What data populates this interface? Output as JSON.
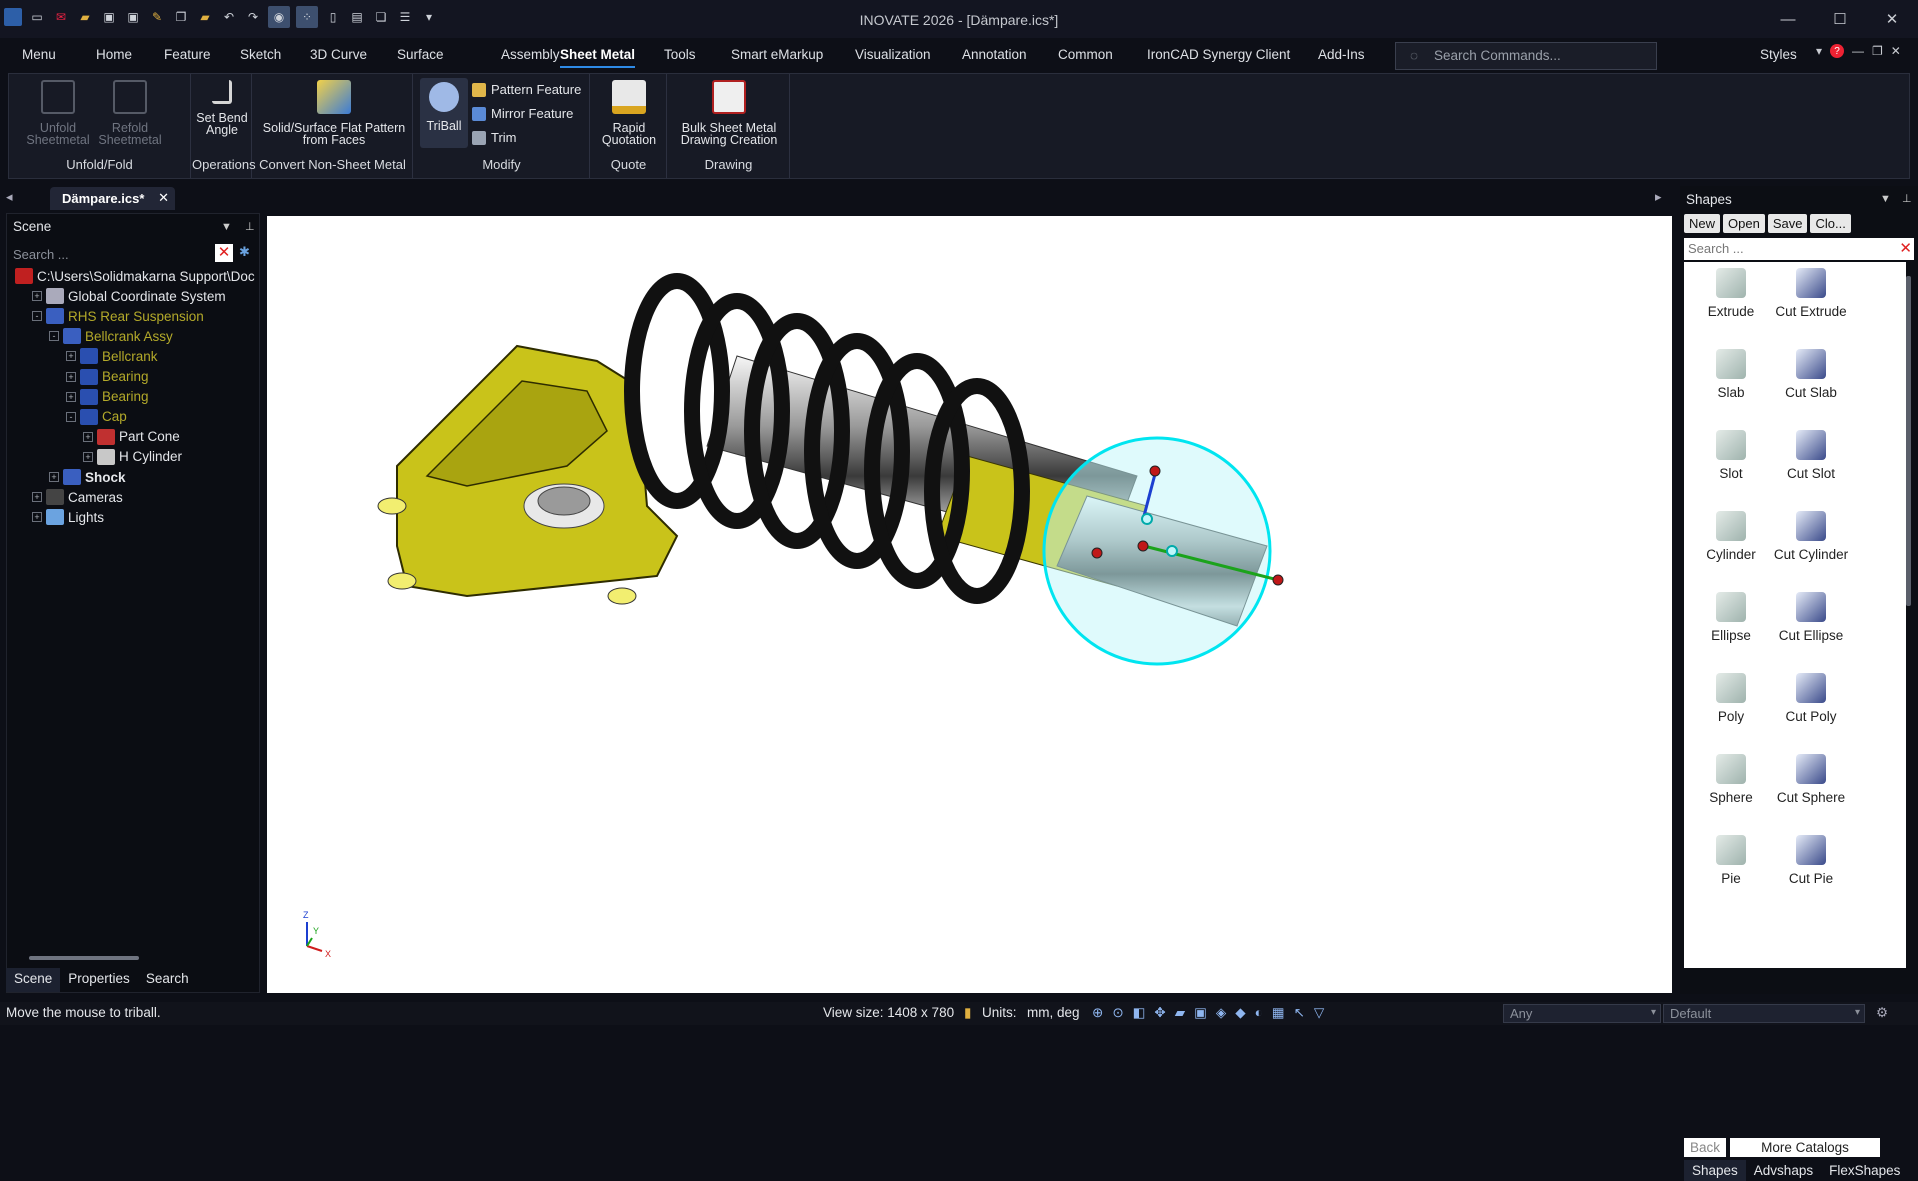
{
  "app": {
    "title": "INOVATE 2026 - [Dämpare.ics*]"
  },
  "menubar": {
    "tabs": [
      "Menu",
      "Home",
      "Feature",
      "Sketch",
      "3D Curve",
      "Surface",
      "Assembly",
      "Sheet Metal",
      "Tools",
      "Smart eMarkup",
      "Visualization",
      "Annotation",
      "Common",
      "IronCAD Synergy Client",
      "Add-Ins"
    ],
    "active": "Sheet Metal",
    "search_placeholder": "Search Commands...",
    "styles_label": "Styles"
  },
  "ribbon": {
    "groups": {
      "unfold_fold": {
        "label": "Unfold/Fold",
        "unfold": "Unfold Sheetmetal",
        "refold": "Refold Sheetmetal"
      },
      "operations": {
        "label": "Operations",
        "set_bend": "Set Bend Angle"
      },
      "convert": {
        "label": "Convert Non-Sheet Metal",
        "flat": "Solid/Surface Flat Pattern from Faces"
      },
      "modify": {
        "label": "Modify",
        "triball": "TriBall",
        "pattern": "Pattern Feature",
        "mirror": "Mirror Feature",
        "trim": "Trim"
      },
      "quote": {
        "label": "Quote",
        "rapid": "Rapid Quotation"
      },
      "drawing": {
        "label": "Drawing",
        "bulk": "Bulk Sheet Metal Drawing Creation"
      }
    }
  },
  "doc_tab": {
    "label": "Dämpare.ics*"
  },
  "scene": {
    "title": "Scene",
    "search_placeholder": "Search ...",
    "tree": [
      {
        "label": "C:\\Users\\Solidmakarna Support\\Doc",
        "level": 0,
        "expander": "",
        "style": "normal"
      },
      {
        "label": "Global Coordinate System",
        "level": 1,
        "expander": "+",
        "style": "normal"
      },
      {
        "label": "RHS Rear Suspension",
        "level": 1,
        "expander": "-",
        "style": "olive"
      },
      {
        "label": "Bellcrank Assy",
        "level": 2,
        "expander": "-",
        "style": "olive"
      },
      {
        "label": "Bellcrank",
        "level": 3,
        "expander": "+",
        "style": "olive"
      },
      {
        "label": "Bearing",
        "level": 3,
        "expander": "+",
        "style": "olive"
      },
      {
        "label": "Bearing",
        "level": 3,
        "expander": "+",
        "style": "olive"
      },
      {
        "label": "Cap",
        "level": 3,
        "expander": "-",
        "style": "olive"
      },
      {
        "label": "Part Cone",
        "level": 4,
        "expander": "+",
        "style": "normal"
      },
      {
        "label": "H Cylinder",
        "level": 4,
        "expander": "+",
        "style": "normal"
      },
      {
        "label": "Shock",
        "level": 2,
        "expander": "+",
        "style": "bold"
      },
      {
        "label": "Cameras",
        "level": 1,
        "expander": "+",
        "style": "normal"
      },
      {
        "label": "Lights",
        "level": 1,
        "expander": "+",
        "style": "normal"
      }
    ],
    "bottom_tabs": [
      "Scene",
      "Properties",
      "Search"
    ]
  },
  "viewport": {
    "axes": {
      "z": "Z",
      "y": "Y",
      "x": "X"
    }
  },
  "shapes": {
    "title": "Shapes",
    "buttons": [
      "New",
      "Open",
      "Save",
      "Clo..."
    ],
    "search_placeholder": "Search ...",
    "items": [
      [
        "Extrude",
        "Cut Extrude"
      ],
      [
        "Slab",
        "Cut Slab"
      ],
      [
        "Slot",
        "Cut Slot"
      ],
      [
        "Cylinder",
        "Cut Cylinder"
      ],
      [
        "Ellipse",
        "Cut Ellipse"
      ],
      [
        "Poly",
        "Cut Poly"
      ],
      [
        "Sphere",
        "Cut Sphere"
      ],
      [
        "Pie",
        "Cut Pie"
      ]
    ],
    "back": "Back",
    "more": "More Catalogs",
    "tabs": [
      "Shapes",
      "Advshaps",
      "FlexShapes"
    ]
  },
  "status": {
    "message": "Move the mouse to triball.",
    "view_size": "View size: 1408 x  780",
    "units_label": "Units:",
    "units_value": "mm, deg",
    "filter": "Any",
    "style": "Default"
  },
  "colors": {
    "accent": "#2e8ae6",
    "part_yellow": "#c8c314",
    "triball": "#00e5f0"
  }
}
